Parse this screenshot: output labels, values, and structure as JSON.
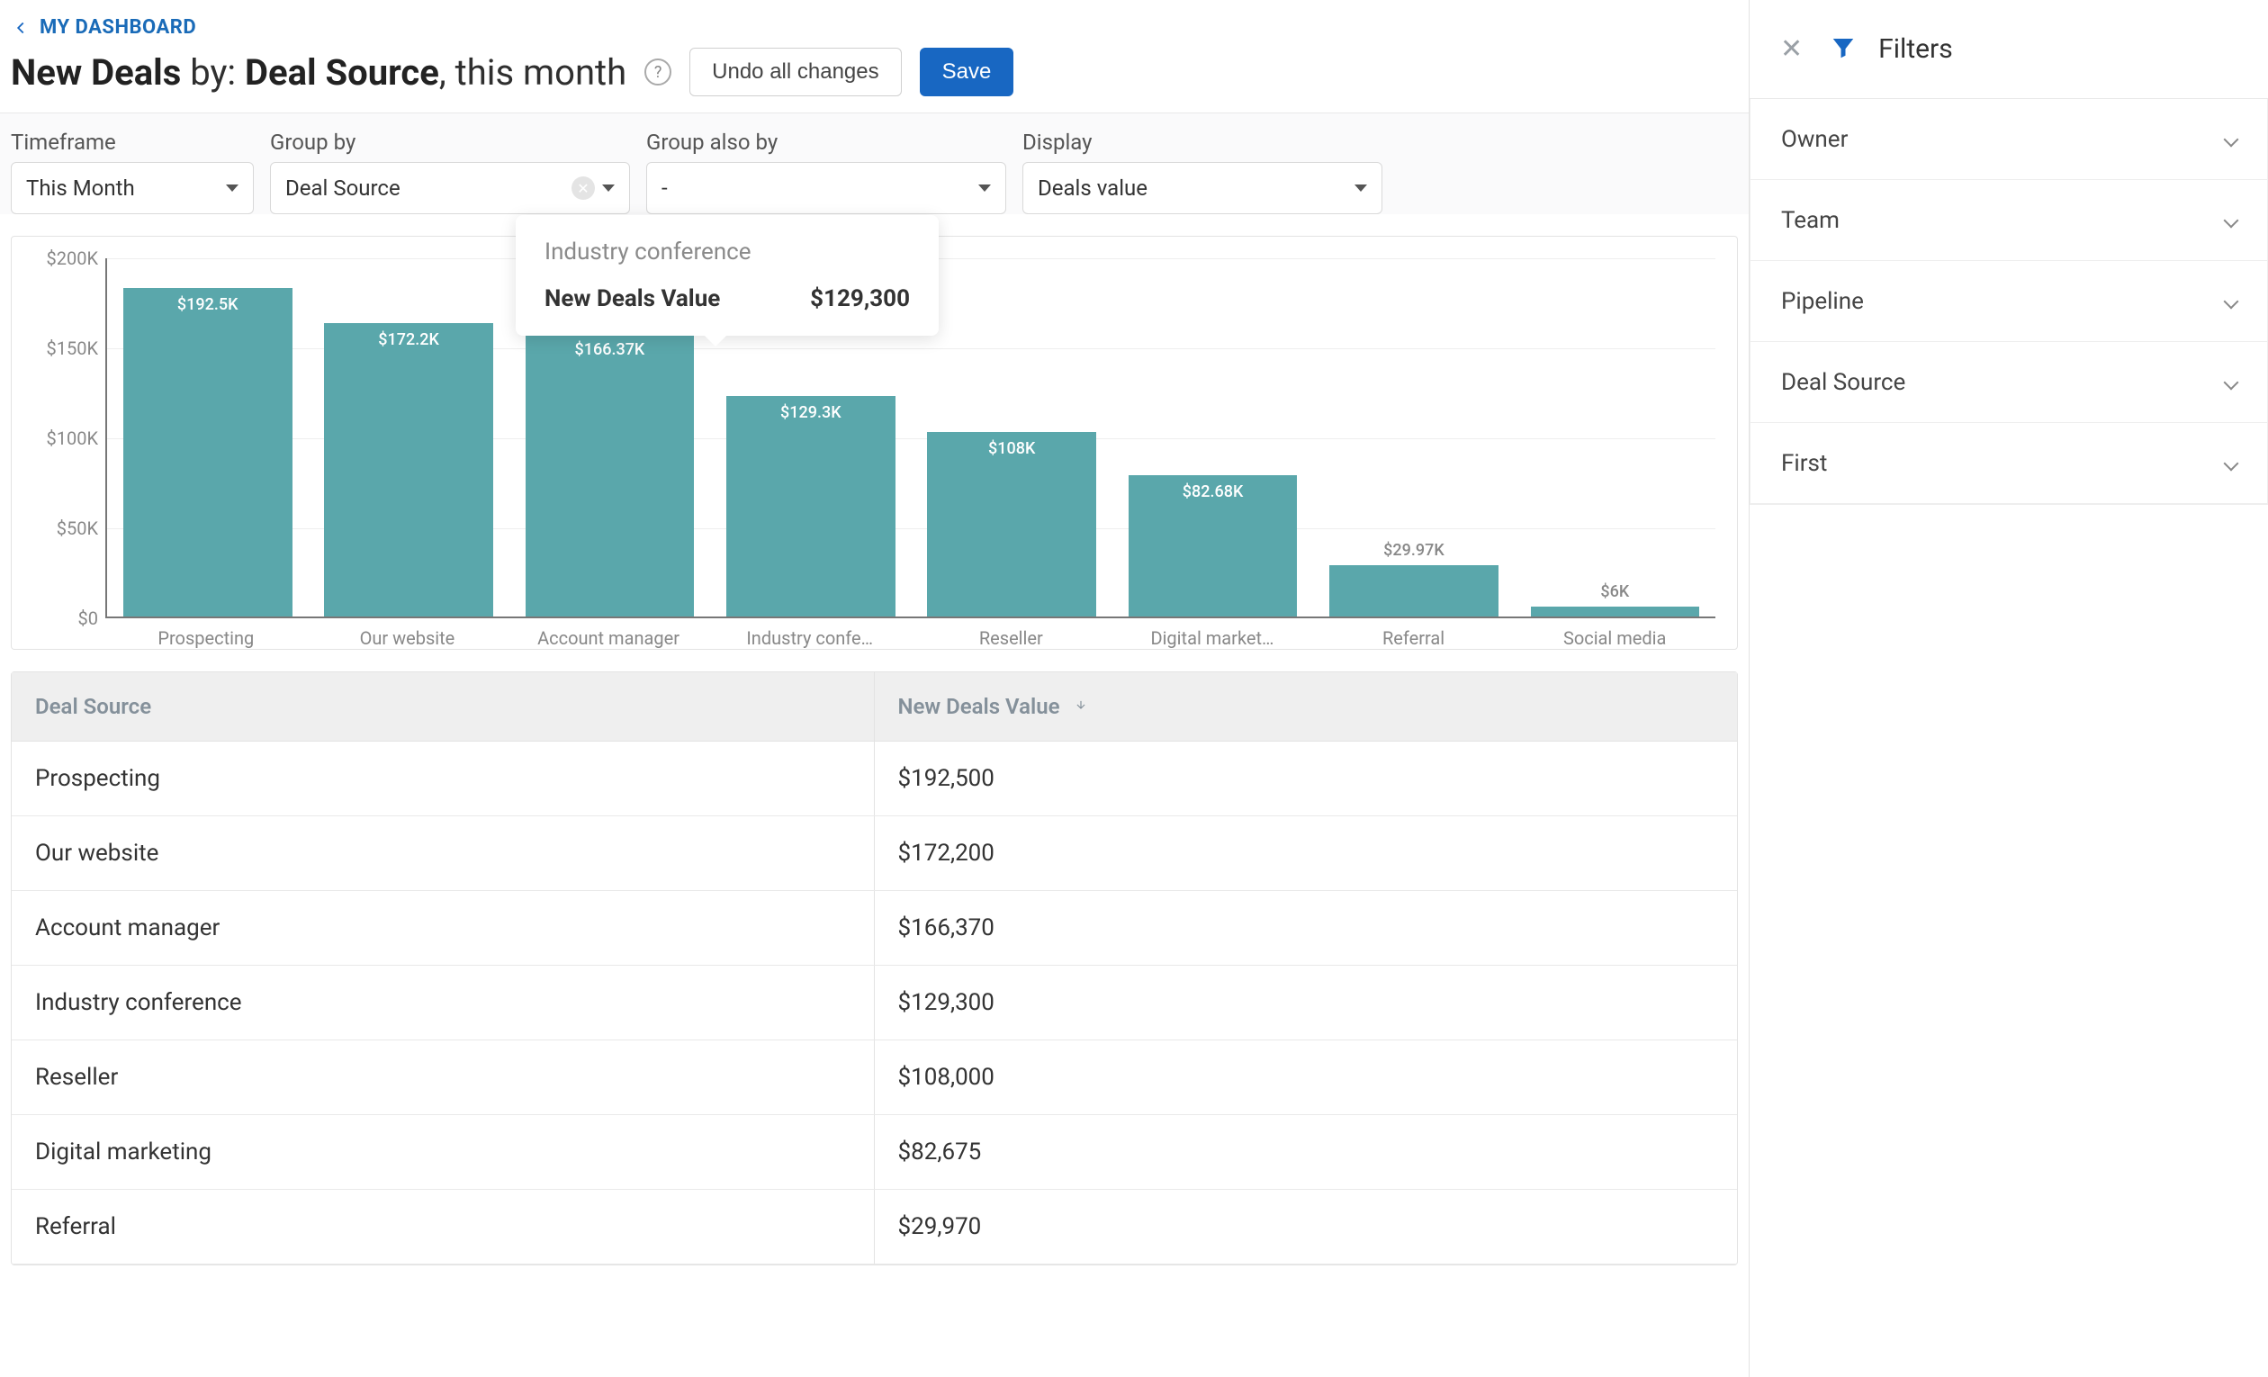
{
  "breadcrumb": {
    "label": "MY DASHBOARD"
  },
  "title": {
    "metric": "New Deals",
    "by_word": "by:",
    "group": "Deal Source",
    "suffix": ", this month"
  },
  "actions": {
    "undo": "Undo all changes",
    "save": "Save"
  },
  "controls": {
    "timeframe": {
      "label": "Timeframe",
      "value": "This Month"
    },
    "groupby": {
      "label": "Group by",
      "value": "Deal Source"
    },
    "groupalso": {
      "label": "Group also by",
      "value": "-"
    },
    "display": {
      "label": "Display",
      "value": "Deals value"
    }
  },
  "tooltip": {
    "category": "Industry conference",
    "metric_label": "New Deals Value",
    "metric_value": "$129,300"
  },
  "chart_data": {
    "type": "bar",
    "title": "",
    "xlabel": "",
    "ylabel": "",
    "ylim": [
      0,
      210000
    ],
    "y_ticks": [
      "$0",
      "$50K",
      "$100K",
      "$150K",
      "$200K"
    ],
    "categories": [
      "Prospecting",
      "Our website",
      "Account manager",
      "Industry confe…",
      "Reseller",
      "Digital market…",
      "Referral",
      "Social media"
    ],
    "values": [
      192500,
      172200,
      166370,
      129300,
      108000,
      82680,
      29970,
      6000
    ],
    "value_labels": [
      "$192.5K",
      "$172.2K",
      "$166.37K",
      "$129.3K",
      "$108K",
      "$82.68K",
      "$29.97K",
      "$6K"
    ],
    "label_above_threshold": 40000
  },
  "table": {
    "columns": [
      "Deal Source",
      "New Deals Value"
    ],
    "sort_col": 1,
    "rows": [
      [
        "Prospecting",
        "$192,500"
      ],
      [
        "Our website",
        "$172,200"
      ],
      [
        "Account manager",
        "$166,370"
      ],
      [
        "Industry conference",
        "$129,300"
      ],
      [
        "Reseller",
        "$108,000"
      ],
      [
        "Digital marketing",
        "$82,675"
      ],
      [
        "Referral",
        "$29,970"
      ]
    ]
  },
  "filters": {
    "title": "Filters",
    "items": [
      "Owner",
      "Team",
      "Pipeline",
      "Deal Source",
      "First"
    ]
  },
  "colors": {
    "bar": "#5aa7ab",
    "primary": "#1867c2"
  }
}
